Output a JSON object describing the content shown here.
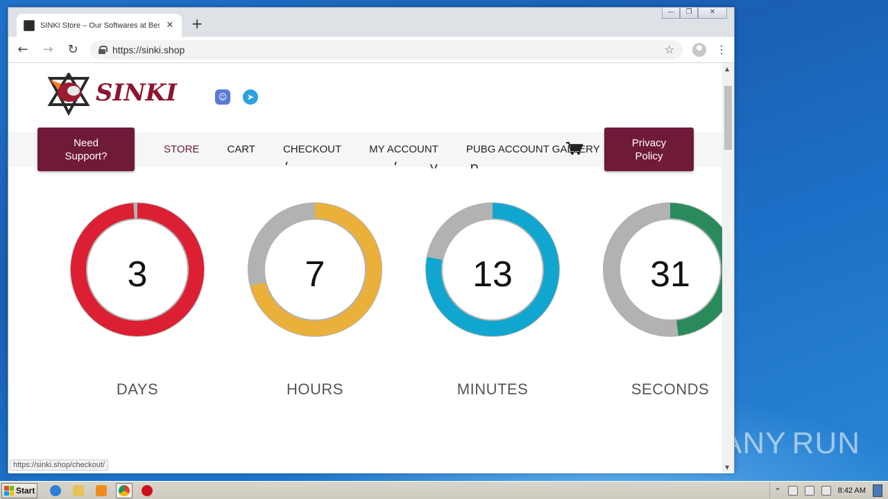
{
  "browser": {
    "tab_title": "SINKI Store – Our Softwares at Best",
    "tab_close": "✕",
    "new_tab": "+",
    "url": "https://sinki.shop",
    "status_url": "https://sinki.shop/checkout/"
  },
  "site": {
    "logo_text": "SINKI",
    "nav": {
      "support_label_line1": "Need",
      "support_label_line2": "Support?",
      "links": [
        "STORE",
        "CART",
        "CHECKOUT",
        "MY ACCOUNT",
        "PUBG ACCOUNT GALLERY"
      ],
      "privacy_label_line1": "Privacy",
      "privacy_label_line2": "Policy"
    },
    "countdown": [
      {
        "value": "3",
        "label": "DAYS",
        "color": "#dc1f33",
        "fraction": 0.99
      },
      {
        "value": "7",
        "label": "HOURS",
        "color": "#ebb03a",
        "fraction": 0.71
      },
      {
        "value": "13",
        "label": "MINUTES",
        "color": "#10a6cf",
        "fraction": 0.78
      },
      {
        "value": "31",
        "label": "SECONDS",
        "color": "#2a8a5c",
        "fraction": 0.48
      }
    ]
  },
  "colors": {
    "brand": "#701a3a",
    "ring_track": "#b2b2b2"
  },
  "taskbar": {
    "start_label": "Start",
    "clock": "8:42 AM"
  },
  "watermark": "ANY RUN"
}
